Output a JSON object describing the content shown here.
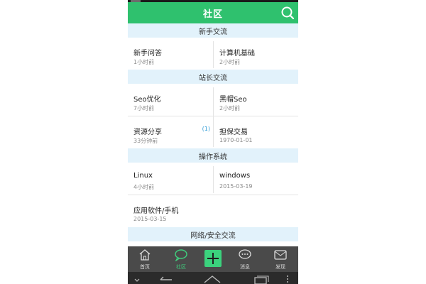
{
  "header": {
    "title": "社区"
  },
  "sections": [
    {
      "title": "新手交流"
    },
    {
      "title": "站长交流"
    },
    {
      "title": "操作系统"
    },
    {
      "title": "网络/安全交流"
    }
  ],
  "forums": {
    "newbie_qa": {
      "name": "新手问答",
      "time": "1小时前"
    },
    "computer_basics": {
      "name": "计算机基础",
      "time": "2小时前"
    },
    "seo_optimization": {
      "name": "Seo优化",
      "time": "7小时前"
    },
    "black_hat_seo": {
      "name": "黑帽Seo",
      "time": "2小时前"
    },
    "resource_sharing": {
      "name": "资源分享",
      "time": "33分钟前",
      "badge": "(1)"
    },
    "guarantee_trade": {
      "name": "担保交易",
      "time": "1970-01-01"
    },
    "linux": {
      "name": "Linux",
      "time": "4小时前"
    },
    "windows": {
      "name": "windows",
      "time": "2015-03-19"
    },
    "apps_mobile": {
      "name": "应用软件/手机",
      "time": "2015-03-15"
    }
  },
  "bottom_nav": {
    "home": "首页",
    "community": "社区",
    "messages": "消息",
    "discover": "发现"
  },
  "active_tab": "community",
  "colors": {
    "brand_green": "#2fc16e",
    "section_bg": "#e2f2fb",
    "badge_blue": "#2e9bd6",
    "nav_bg": "#4a4a4a",
    "active_green": "#3fd07e"
  },
  "icons": [
    "search-icon",
    "home-icon",
    "chat-bubble-icon",
    "plus-icon",
    "message-icon",
    "discover-icon",
    "back-icon",
    "home-key-icon",
    "recents-icon"
  ]
}
